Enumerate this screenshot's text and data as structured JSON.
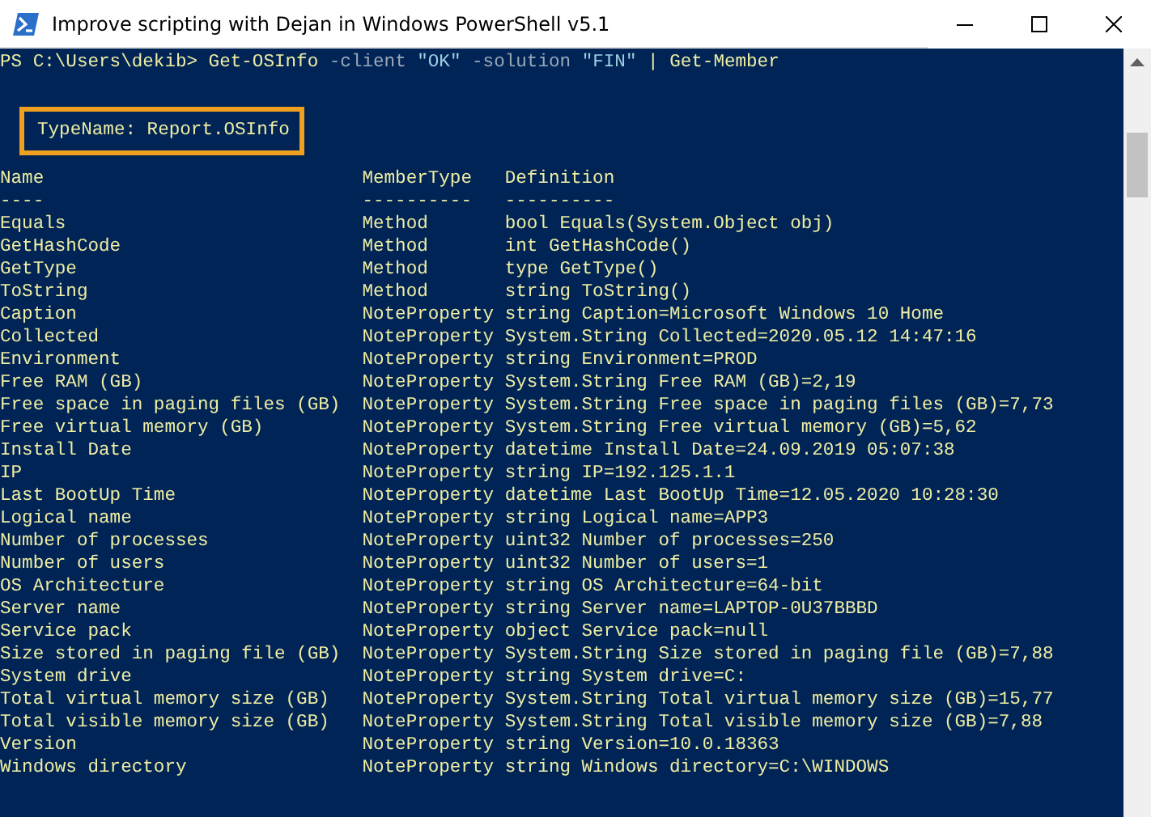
{
  "window": {
    "title": "Improve scripting with Dejan in Windows PowerShell v5.1"
  },
  "prompt": [
    {
      "kind": "plain",
      "text": "PS C:\\Users\\dekib> Get-OSInfo "
    },
    {
      "kind": "parameter",
      "text": "-client "
    },
    {
      "kind": "string",
      "text": "\"OK\" "
    },
    {
      "kind": "parameter",
      "text": "-solution "
    },
    {
      "kind": "string",
      "text": "\"FIN\" "
    },
    {
      "kind": "plain",
      "text": "| Get-Member"
    }
  ],
  "type_name": {
    "text": "TypeName: Report.OSInfo",
    "highlighted": true
  },
  "table": {
    "columns": [
      "Name",
      "MemberType",
      "Definition"
    ],
    "underlines": [
      "----",
      "----------",
      "----------"
    ],
    "rows": [
      [
        "Equals",
        "Method",
        "bool Equals(System.Object obj)"
      ],
      [
        "GetHashCode",
        "Method",
        "int GetHashCode()"
      ],
      [
        "GetType",
        "Method",
        "type GetType()"
      ],
      [
        "ToString",
        "Method",
        "string ToString()"
      ],
      [
        "Caption",
        "NoteProperty",
        "string Caption=Microsoft Windows 10 Home"
      ],
      [
        "Collected",
        "NoteProperty",
        "System.String Collected=2020.05.12 14:47:16"
      ],
      [
        "Environment",
        "NoteProperty",
        "string Environment=PROD"
      ],
      [
        "Free RAM (GB)",
        "NoteProperty",
        "System.String Free RAM (GB)=2,19"
      ],
      [
        "Free space in paging files (GB)",
        "NoteProperty",
        "System.String Free space in paging files (GB)=7,73"
      ],
      [
        "Free virtual memory (GB)",
        "NoteProperty",
        "System.String Free virtual memory (GB)=5,62"
      ],
      [
        "Install Date",
        "NoteProperty",
        "datetime Install Date=24.09.2019 05:07:38"
      ],
      [
        "IP",
        "NoteProperty",
        "string IP=192.125.1.1"
      ],
      [
        "Last BootUp Time",
        "NoteProperty",
        "datetime Last BootUp Time=12.05.2020 10:28:30"
      ],
      [
        "Logical name",
        "NoteProperty",
        "string Logical name=APP3"
      ],
      [
        "Number of processes",
        "NoteProperty",
        "uint32 Number of processes=250"
      ],
      [
        "Number of users",
        "NoteProperty",
        "uint32 Number of users=1"
      ],
      [
        "OS Architecture",
        "NoteProperty",
        "string OS Architecture=64-bit"
      ],
      [
        "Server name",
        "NoteProperty",
        "string Server name=LAPTOP-0U37BBBD"
      ],
      [
        "Service pack",
        "NoteProperty",
        "object Service pack=null"
      ],
      [
        "Size stored in paging file (GB)",
        "NoteProperty",
        "System.String Size stored in paging file (GB)=7,88"
      ],
      [
        "System drive",
        "NoteProperty",
        "string System drive=C:"
      ],
      [
        "Total virtual memory size (GB)",
        "NoteProperty",
        "System.String Total virtual memory size (GB)=15,77"
      ],
      [
        "Total visible memory size (GB)",
        "NoteProperty",
        "System.String Total visible memory size (GB)=7,88"
      ],
      [
        "Version",
        "NoteProperty",
        "string Version=10.0.18363"
      ],
      [
        "Windows directory",
        "NoteProperty",
        "string Windows directory=C:\\WINDOWS"
      ]
    ]
  }
}
